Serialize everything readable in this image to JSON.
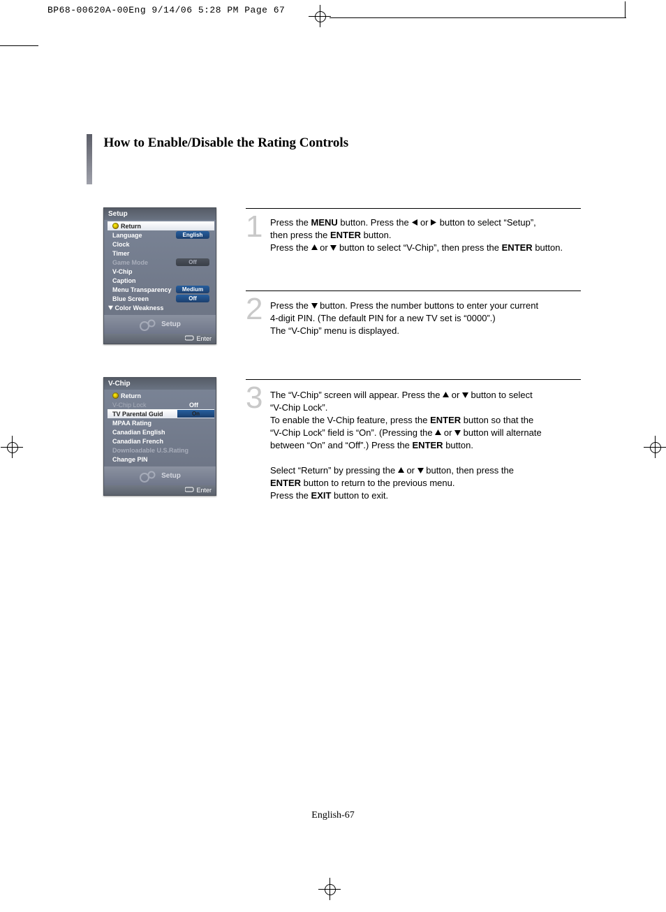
{
  "print": {
    "header": "BP68-00620A-00Eng  9/14/06  5:28 PM  Page 67"
  },
  "heading": "How to Enable/Disable the Rating Controls",
  "steps": {
    "n1": "1",
    "n2": "2",
    "n3": "3",
    "s1a_1": "Press the ",
    "s1a_b1": "MENU",
    "s1a_2": " button. Press the ",
    "s1a_3": " or ",
    "s1a_4": " button to select “Setup”,",
    "s1b_1": "then press  the ",
    "s1b_b1": "ENTER",
    "s1b_2": " button.",
    "s1c_1": "Press the ",
    "s1c_2": " or ",
    "s1c_3": " button to select “V-Chip”, then press the ",
    "s1c_b1": "ENTER",
    "s1c_4": " button.",
    "s2a_1": "Press the ",
    "s2a_2": " button. Press the number buttons to enter your current",
    "s2b": "4-digit PIN. (The default PIN for a new TV set is “0000”.)",
    "s2c": "The “V-Chip” menu is displayed.",
    "s3a_1": "The “V-Chip” screen will appear. Press the ",
    "s3a_2": " or ",
    "s3a_3": " button to select",
    "s3b": "“V-Chip Lock”.",
    "s3c_1": "To enable the V-Chip feature, press the ",
    "s3c_b1": "ENTER",
    "s3c_2": " button so that the",
    "s3d_1": "“V-Chip Lock” field is “On”. (Pressing the ",
    "s3d_2": " or ",
    "s3d_3": " button will alternate",
    "s3e_1": "between “On” and “Off”.) Press the ",
    "s3e_b1": "ENTER",
    "s3e_2": " button.",
    "s3f_1": "Select “Return” by pressing the ",
    "s3f_2": " or ",
    "s3f_3": " button, then press the",
    "s3g_b1": "ENTER",
    "s3g_1": " button to return to the previous menu.",
    "s3h_1": "Press the ",
    "s3h_b1": "EXIT",
    "s3h_2": " button to exit."
  },
  "osd1": {
    "title": "Setup",
    "return": "Return",
    "items": [
      "Language",
      "Clock",
      "Timer",
      "Game Mode",
      "V-Chip",
      "Caption",
      "Menu Transparency",
      "Blue Screen",
      "Color Weakness"
    ],
    "vals": {
      "lang": "English",
      "game": "Off",
      "trans": "Medium",
      "blue": "Off"
    },
    "band": "Setup",
    "enter": "Enter"
  },
  "osd2": {
    "title": "V-Chip",
    "return": "Return",
    "items": [
      "V-Chip Lock",
      "TV Parental Guid",
      "MPAA Rating",
      "Canadian English",
      "Canadian French",
      "Downloadable U.S.Rating",
      "Change PIN"
    ],
    "vals": {
      "off": "Off",
      "on": "On"
    },
    "band": "Setup",
    "enter": "Enter"
  },
  "pagenum": "English-67"
}
